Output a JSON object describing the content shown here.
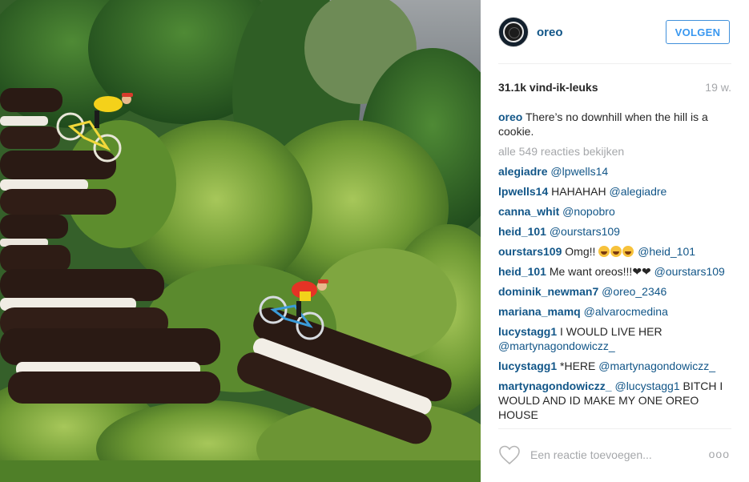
{
  "post": {
    "photo_alt": "",
    "author": "oreo",
    "follow_label": "VOLGEN",
    "likes": "31.1k vind-ik-leuks",
    "age": "19 w.",
    "caption": {
      "user": "oreo",
      "text": "There’s no downhill when the hill is a cookie."
    },
    "view_all": "alle 549 reacties bekijken",
    "comments": [
      {
        "user": "alegiadre",
        "text": "",
        "mention": "@lpwells14",
        "trailing": ""
      },
      {
        "user": "lpwells14",
        "text": "HAHAHAH",
        "mention": "@alegiadre",
        "trailing": ""
      },
      {
        "user": "canna_whit",
        "text": "",
        "mention": "@nopobro",
        "trailing": ""
      },
      {
        "user": "heid_101",
        "text": "",
        "mention": "@ourstars109",
        "trailing": ""
      },
      {
        "user": "ourstars109",
        "text": "Omg!!",
        "mention": "@heid_101",
        "trailing": "",
        "emoji_count": 3,
        "emoji_name": "face-with-tears-of-joy"
      },
      {
        "user": "heid_101",
        "text": "Me want oreos!!!❤❤",
        "mention": "@ourstars109",
        "trailing": ""
      },
      {
        "user": "dominik_newman7",
        "text": "",
        "mention": "@oreo_2346",
        "trailing": ""
      },
      {
        "user": "mariana_mamq",
        "text": "",
        "mention": "@alvarocmedina",
        "trailing": ""
      },
      {
        "user": "lucystagg1",
        "text": "I WOULD LIVE HER",
        "mention": "@martynagondowiczz_",
        "trailing": ""
      },
      {
        "user": "lucystagg1",
        "text": "*HERE",
        "mention": "@martynagondowiczz_",
        "trailing": ""
      },
      {
        "user": "martynagondowiczz_",
        "text": "",
        "mention": "@lucystagg1",
        "trailing": "BITCH I WOULD AND ID MAKE MY ONE OREO HOUSE"
      }
    ],
    "add_comment_placeholder": "Een reactie toevoegen...",
    "more_label": "ooo"
  },
  "icons": {
    "like": "heart-outline-icon",
    "more": "more-options-icon"
  },
  "colors": {
    "link": "#125688",
    "follow": "#3897f0",
    "muted": "#a5a7aa",
    "text": "#262626"
  }
}
